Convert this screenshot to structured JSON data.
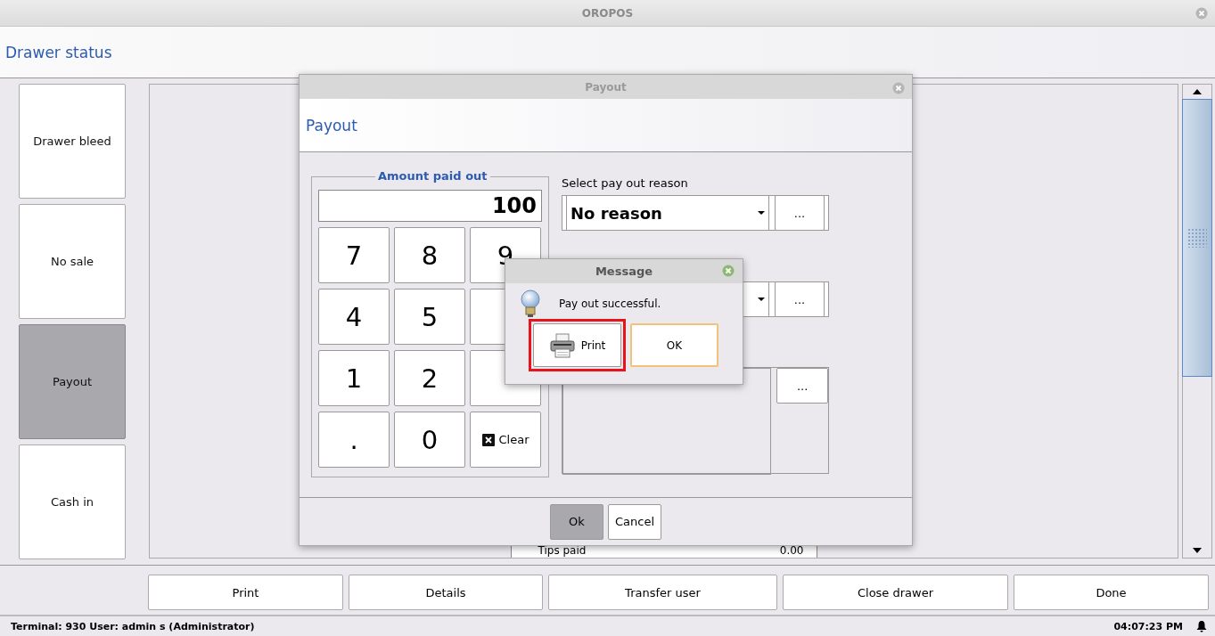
{
  "window": {
    "title": "OROPOS"
  },
  "header": {
    "title": "Drawer status"
  },
  "side_buttons": [
    {
      "label": "Drawer bleed",
      "selected": false
    },
    {
      "label": "No sale",
      "selected": false
    },
    {
      "label": "Payout",
      "selected": true
    },
    {
      "label": "Cash in",
      "selected": false
    }
  ],
  "report": {
    "rows": [
      {
        "label": "Tips paid",
        "value": "0.00"
      }
    ]
  },
  "bottom_buttons": [
    "Print",
    "Details",
    "Transfer user",
    "Close drawer",
    "Done"
  ],
  "status_bar": {
    "info": "Terminal: 930 User: admin s (Administrator)",
    "time": "04:07:23 PM"
  },
  "payout_dialog": {
    "title": "Payout",
    "header": "Payout",
    "amount": {
      "legend": "Amount paid out",
      "value": "100"
    },
    "keys": [
      {
        "kind": "digit",
        "label": "7"
      },
      {
        "kind": "digit",
        "label": "8"
      },
      {
        "kind": "digit",
        "label": "9"
      },
      {
        "kind": "digit",
        "label": "4"
      },
      {
        "kind": "digit",
        "label": "5"
      },
      {
        "kind": "digit"
      },
      {
        "kind": "digit",
        "label": "1"
      },
      {
        "kind": "digit",
        "label": "2"
      },
      {
        "kind": "digit"
      },
      {
        "kind": "digit",
        "label": "."
      },
      {
        "kind": "digit",
        "label": "0"
      },
      {
        "kind": "clear",
        "label": "Clear"
      }
    ],
    "reason_label": "Select pay out reason",
    "fields": [
      {
        "kind": "select",
        "value": "No reason",
        "button": "..."
      },
      {
        "kind": "select",
        "button": "..."
      },
      {
        "kind": "textarea",
        "button": "..."
      }
    ],
    "buttons": [
      {
        "label": "Ok",
        "selected": true
      },
      {
        "label": "Cancel",
        "selected": false
      }
    ]
  },
  "message_dialog": {
    "title": "Message",
    "text": "Pay out successful.",
    "buttons": [
      {
        "label": "Print",
        "kind": "print",
        "highlighted": true,
        "focused": false
      },
      {
        "label": "OK",
        "kind": "plain",
        "highlighted": false,
        "focused": true
      }
    ]
  }
}
